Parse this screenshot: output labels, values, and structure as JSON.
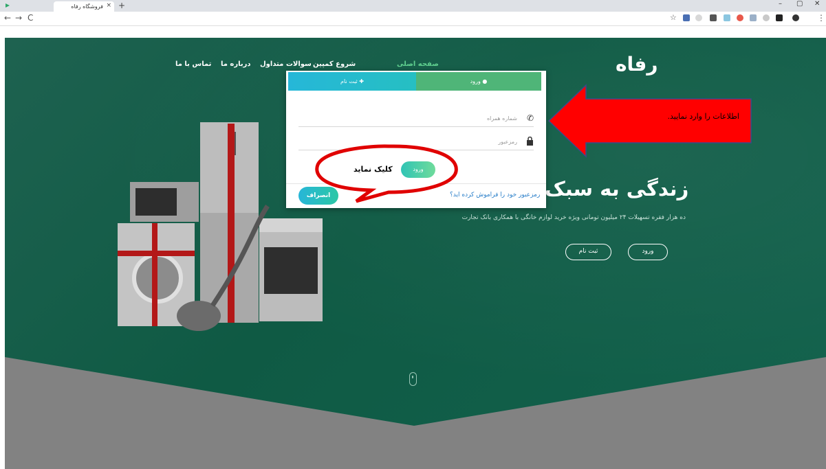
{
  "browser": {
    "tab_title": "فروشگاه رفاه",
    "tab_close": "×",
    "new_tab": "+",
    "minimize": "–",
    "maximize": "▢",
    "close": "✕",
    "back": "←",
    "forward": "→",
    "reload": "C",
    "star": "☆",
    "menu": "⋮"
  },
  "nav": {
    "brand": "رفاه",
    "items": [
      "صفحه اصلی",
      "شروع کمپین",
      "سوالات متداول",
      "درباره ما",
      "تماس با ما"
    ]
  },
  "hero": {
    "title": "زندگی به سبک",
    "subtitle": "ده هزار فقره تسهیلات ۲۴ میلیون تومانی ویژه خرید لوازم خانگی با همکاری بانک تجارت",
    "login_button": "ورود",
    "register_button": "ثبت نام"
  },
  "modal": {
    "tab_login": "ورود",
    "tab_register": "ثبت نام",
    "phone_placeholder": "شماره همراه",
    "password_placeholder": "رمزعبور",
    "login_button": "ورود",
    "forgot_link": "رمزعبور خود را فراموش کرده اید؟",
    "cancel_button": "انصراف"
  },
  "annotations": {
    "arrow_text": "اطلاعات را وارد نمایید.",
    "bubble_text": "کلیک نماید"
  },
  "colors": {
    "hero_green": "#0f5a44",
    "tab_active": "#4fb578",
    "accent_cyan": "#27b6d8",
    "annotation_red": "#ff0000"
  }
}
